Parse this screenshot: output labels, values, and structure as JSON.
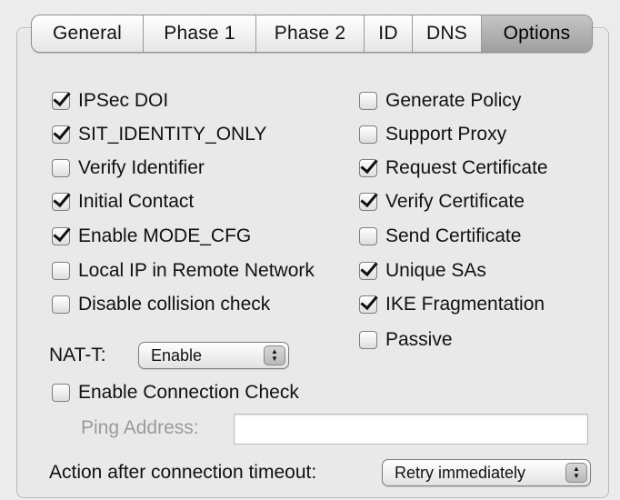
{
  "tabs": [
    "General",
    "Phase 1",
    "Phase 2",
    "ID",
    "DNS",
    "Options"
  ],
  "active_tab": "Options",
  "left_options": [
    {
      "label": "IPSec DOI",
      "checked": true
    },
    {
      "label": "SIT_IDENTITY_ONLY",
      "checked": true
    },
    {
      "label": "Verify Identifier",
      "checked": false
    },
    {
      "label": "Initial Contact",
      "checked": true
    },
    {
      "label": "Enable MODE_CFG",
      "checked": true
    },
    {
      "label": "Local IP in Remote Network",
      "checked": false
    },
    {
      "label": "Disable collision check",
      "checked": false
    }
  ],
  "right_options": [
    {
      "label": "Generate Policy",
      "checked": false
    },
    {
      "label": "Support Proxy",
      "checked": false
    },
    {
      "label": "Request Certificate",
      "checked": true
    },
    {
      "label": "Verify Certificate",
      "checked": true
    },
    {
      "label": "Send Certificate",
      "checked": false
    },
    {
      "label": "Unique SAs",
      "checked": true
    },
    {
      "label": "IKE Fragmentation",
      "checked": true
    },
    {
      "label": "Passive",
      "checked": false
    }
  ],
  "nat_t": {
    "label": "NAT-T:",
    "value": "Enable"
  },
  "enable_connection_check": {
    "label": "Enable Connection Check",
    "checked": false
  },
  "ping_address": {
    "label": "Ping Address:",
    "value": ""
  },
  "timeout_action": {
    "label": "Action after connection timeout:",
    "value": "Retry immediately"
  },
  "icons": {
    "checkmark": "checkmark-icon",
    "popup_arrows": "updown-arrows-icon"
  }
}
